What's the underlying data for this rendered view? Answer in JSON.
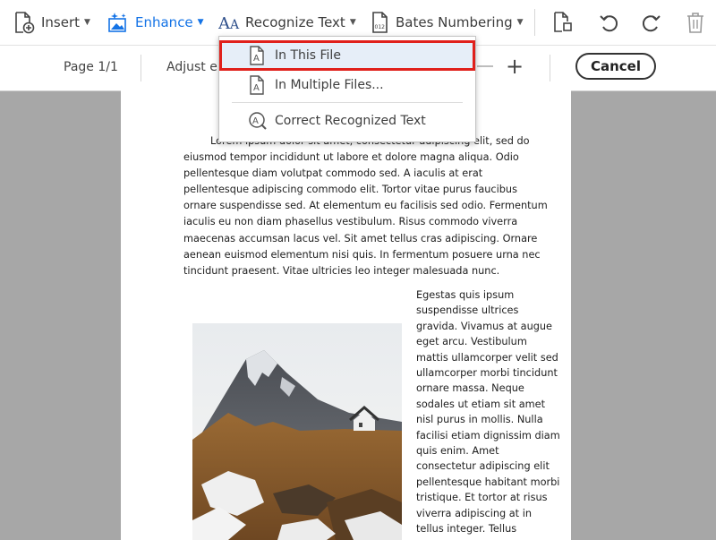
{
  "toolbar": {
    "insert_label": "Insert",
    "enhance_label": "Enhance",
    "recognize_text_label": "Recognize Text",
    "bates_label": "Bates Numbering"
  },
  "subbar": {
    "page_indicator": "Page 1/1",
    "adjust_label": "Adjust en",
    "plus_label": "+",
    "cancel_label": "Cancel"
  },
  "menu": {
    "items": [
      {
        "label": "In This File"
      },
      {
        "label": "In Multiple Files..."
      },
      {
        "label": "Correct Recognized Text"
      }
    ]
  },
  "document": {
    "paragraph": "Lorem ipsum dolor sit amet, consectetur adipiscing elit, sed do eiusmod tempor incididunt ut labore et dolore magna aliqua. Odio pellentesque diam volutpat commodo sed. A iaculis at erat pellentesque adipiscing commodo elit. Tortor vitae purus faucibus ornare suspendisse sed. At elementum eu facilisis sed odio. Fermentum iaculis eu non diam phasellus vestibulum. Risus commodo viverra maecenas accumsan lacus vel. Sit amet tellus cras adipiscing. Ornare aenean euismod elementum nisi quis. In fermentum posuere urna nec tincidunt praesent. Vitae ultricies leo integer malesuada nunc.",
    "column_text": "Egestas quis ipsum suspendisse ultrices gravida. Vivamus at augue eget arcu. Vestibulum mattis ullamcorper velit sed ullamcorper morbi tincidunt ornare massa. Neque sodales ut etiam sit amet nisl purus in mollis. Nulla facilisi etiam dignissim diam quis enim. Amet consectetur adipiscing elit pellentesque habitant morbi tristique. Et tortor at risus viverra adipiscing at in tellus integer. Tellus molestie nunc non blandit."
  },
  "colors": {
    "accent": "#1473e6",
    "highlight_border": "#e0201b",
    "canvas": "#a7a7a7"
  },
  "icons": [
    "insert-file-icon",
    "enhance-image-icon",
    "recognize-text-icon",
    "bates-numbering-icon",
    "page-edit-icon",
    "rotate-left-icon",
    "rotate-right-icon",
    "trash-icon",
    "file-ocr-icon",
    "multi-file-ocr-icon",
    "correct-text-icon"
  ]
}
